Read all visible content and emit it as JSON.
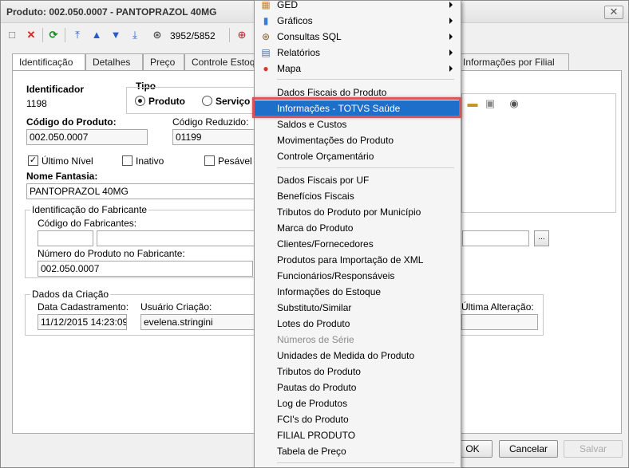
{
  "window": {
    "title": "Produto: 002.050.0007 - PANTOPRAZOL 40MG",
    "close_glyph": "✕"
  },
  "toolbar": {
    "record_counter": "3952/5852"
  },
  "tabs": [
    "Identificação",
    "Detalhes",
    "Preço",
    "Controle Estoq",
    "Informações por Filial"
  ],
  "form": {
    "identificador_label": "Identificador",
    "identificador_value": "1198",
    "tipo_label": "Tipo",
    "tipo_options": [
      "Produto",
      "Serviço"
    ],
    "tipo_selected": "Produto",
    "codigo_produto_label": "Código do Produto:",
    "codigo_produto_value": "002.050.0007",
    "codigo_reduzido_label": "Código Reduzido:",
    "codigo_reduzido_value": "01199",
    "ultimo_nivel_label": "Último Nível",
    "ultimo_nivel_checked": true,
    "inativo_label": "Inativo",
    "pesavel_label": "Pesável",
    "nome_fantasia_label": "Nome Fantasia:",
    "nome_fantasia_value": "PANTOPRAZOL 40MG",
    "fabricante_group": "Identificação do Fabricante",
    "codigo_fabricantes_label": "Código do Fabricantes:",
    "numero_fabricante_label": "Número do Produto no Fabricante:",
    "numero_fabricante_value": "002.050.0007",
    "dados_criacao_group": "Dados da Criação",
    "data_cadastramento_label": "Data Cadastramento:",
    "data_cadastramento_value": "11/12/2015 14:23:09",
    "usuario_criacao_label": "Usuário Criação:",
    "usuario_criacao_value": "evelena.stringini",
    "ultima_alteracao_label": "Última Alteração:",
    "ellipsis": "..."
  },
  "buttons": {
    "ok": "OK",
    "cancelar": "Cancelar",
    "salvar": "Salvar"
  },
  "menu": {
    "top_items": [
      {
        "label": "GED",
        "icon": "ged-icon",
        "glyph": "▦",
        "color": "#c8862a"
      },
      {
        "label": "Gráficos",
        "icon": "chart-icon",
        "glyph": "▮",
        "color": "#3a7bd5"
      },
      {
        "label": "Consultas SQL",
        "icon": "binoculars-icon",
        "glyph": "⊛",
        "color": "#7a5a2a"
      },
      {
        "label": "Relatórios",
        "icon": "report-icon",
        "glyph": "▤",
        "color": "#4a6fa5"
      },
      {
        "label": "Mapa",
        "icon": "map-pin-icon",
        "glyph": "●",
        "color": "#d23a2a"
      }
    ],
    "group1": [
      "Dados Fiscais do Produto",
      "Informações - TOTVS Saúde",
      "Saldos e Custos",
      "Movimentações do Produto",
      "Controle Orçamentário"
    ],
    "group2": [
      "Dados Fiscais por UF",
      "Benefícios Fiscais",
      "Tributos do Produto por Município",
      "Marca do Produto",
      "Clientes/Fornecedores",
      "Produtos para Importação de XML",
      "Funcionários/Responsáveis",
      "Informações do Estoque",
      "Substituto/Similar",
      "Lotes do Produto",
      "Números de Série",
      "Unidades de Medida do Produto",
      "Tributos do Produto",
      "Pautas do Produto",
      "Log de Produtos",
      "FCI's do Produto",
      "FILIAL PRODUTO",
      "Tabela de Preço"
    ],
    "highlighted": "Informações - TOTVS Saúde",
    "disabled": [
      "Números de Série"
    ],
    "highlight_color": "#1e6fc9",
    "callout_color": "#d9535b"
  }
}
